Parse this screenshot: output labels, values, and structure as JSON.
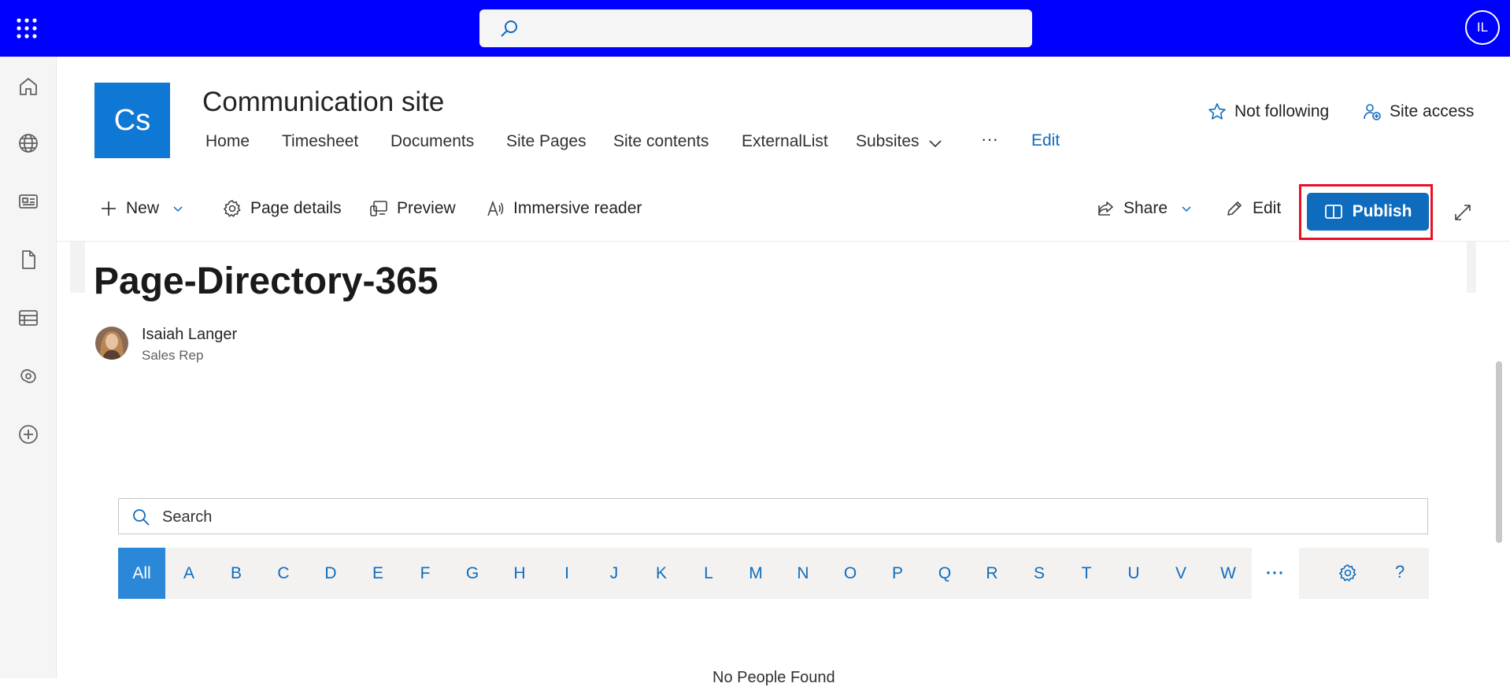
{
  "suite_bar": {
    "avatar_initials": "IL",
    "search_placeholder": "",
    "background_color": "#0000ff"
  },
  "left_rail": {
    "icons": [
      "home-icon",
      "globe-icon",
      "news-icon",
      "document-icon",
      "list-icon",
      "loop-icon",
      "add-icon"
    ]
  },
  "site": {
    "logo_text": "Cs",
    "title": "Communication site",
    "nav": [
      "Home",
      "Timesheet",
      "Documents",
      "Site Pages",
      "Site contents",
      "ExternalList",
      "Subsites"
    ],
    "nav_more": "···",
    "nav_edit": "Edit",
    "follow_label": "Not following",
    "site_access_label": "Site access"
  },
  "command_bar": {
    "new_label": "New",
    "page_details_label": "Page details",
    "preview_label": "Preview",
    "immersive_reader_label": "Immersive reader",
    "share_label": "Share",
    "edit_label": "Edit",
    "publish_label": "Publish"
  },
  "page": {
    "title": "Page-Directory-365",
    "author_name": "Isaiah Langer",
    "author_role": "Sales Rep"
  },
  "directory": {
    "search_placeholder": "Search",
    "letters": [
      "All",
      "A",
      "B",
      "C",
      "D",
      "E",
      "F",
      "G",
      "H",
      "I",
      "J",
      "K",
      "L",
      "M",
      "N",
      "O",
      "P",
      "Q",
      "R",
      "S",
      "T",
      "U",
      "V",
      "W"
    ],
    "active_letter": "All",
    "more_label": "···",
    "help_label": "?",
    "no_results": "No People Found"
  },
  "colors": {
    "accent": "#0f6cbd",
    "highlight_outline": "#e81123",
    "active_letter_bg": "#2b88d8"
  }
}
